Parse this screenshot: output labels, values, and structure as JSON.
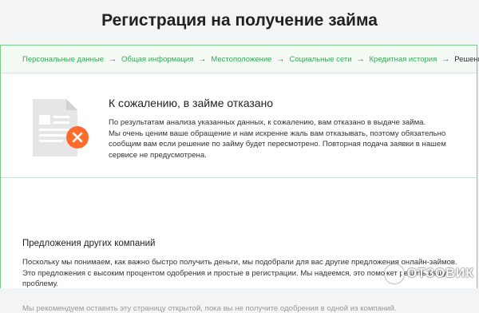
{
  "page": {
    "title": "Регистрация на получение займа"
  },
  "steps": [
    {
      "label": "Персональные данные"
    },
    {
      "label": "Общая информация"
    },
    {
      "label": "Местоположение"
    },
    {
      "label": "Социальные сети"
    },
    {
      "label": "Кредитная история"
    },
    {
      "label": "Решение"
    }
  ],
  "step_arrow": "→",
  "decline": {
    "title": "К сожалению, в займе отказано",
    "line1": "По результатам анализа указанных данных, к сожалению, вам отказано в выдаче займа.",
    "line2": "Мы очень ценим ваше обращение и нам искренне жаль вам отказывать, поэтому обязательно сообщим вам если решение по займу будет пересмотрено. Повторная подача заявки в нашем сервисе не предусмотрена.",
    "icon": "document-declined-icon",
    "colors": {
      "badge": "#ff6b2c",
      "doc": "#e6e6e6"
    }
  },
  "offers": {
    "title": "Предложения других компаний",
    "text": "Поскольку мы понимаем, как важно быстро получить деньги, мы подобрали для вас другие предложения онлайн-займов. Это предложения с высоким процентом одобрения и простые в регистрации. Мы надеемся, это поможет решить вашу проблему.",
    "note": "Мы рекомендуем оставить эту страницу открытой, пока вы не получите одобрения в одной из компаний."
  },
  "watermark": {
    "text": "ОТЗОВИК"
  },
  "colors": {
    "accent": "#3aa55a",
    "border": "#7cc98a"
  }
}
